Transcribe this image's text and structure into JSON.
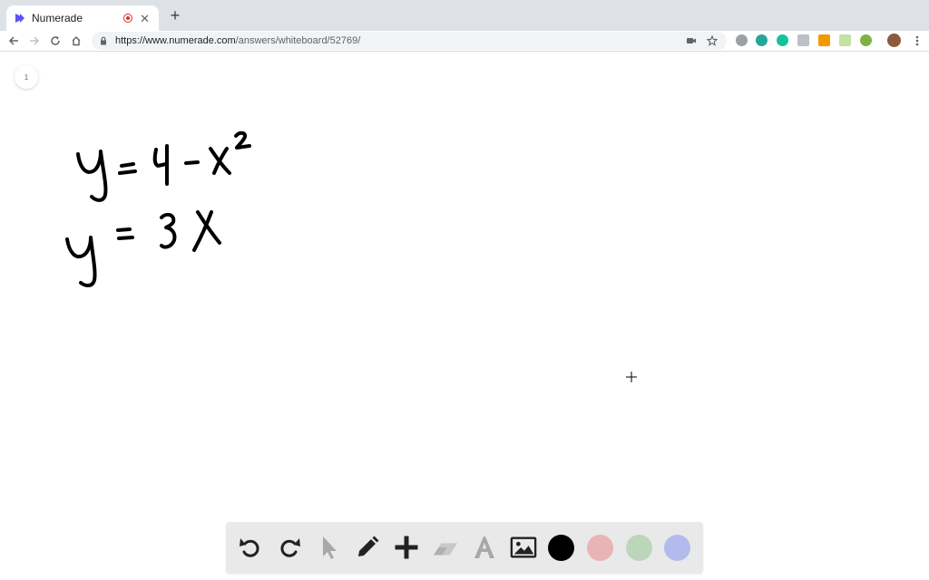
{
  "browser": {
    "tab": {
      "title": "Numerade"
    },
    "new_tab_label": "+",
    "address": {
      "url_host": "https://www.numerade.com",
      "url_path": "/answers/whiteboard/52769/"
    },
    "extensions": [
      {
        "name": "abp-icon",
        "color": "#9aa0a6"
      },
      {
        "name": "circle-teal-icon",
        "color": "#26a69a"
      },
      {
        "name": "grammarly-icon",
        "color": "#15c39a"
      },
      {
        "name": "notes-icon",
        "color": "#bdc1c6"
      },
      {
        "name": "key-icon",
        "color": "#f29900"
      },
      {
        "name": "screen-icon",
        "color": "#c5e1a5"
      },
      {
        "name": "chrome-ext-icon",
        "color": "#7cb342"
      },
      {
        "name": "profile-avatar",
        "color": "#8d5a3b"
      }
    ]
  },
  "whiteboard": {
    "page_number": "1",
    "colors": {
      "ink": "#000000",
      "black": "#000000",
      "pink": "#e8b4b4",
      "green": "#bcd6bc",
      "blue": "#b3bbec"
    }
  },
  "tools": [
    {
      "name": "undo-icon",
      "state": "enabled"
    },
    {
      "name": "redo-icon",
      "state": "enabled"
    },
    {
      "name": "pointer-icon",
      "state": "disabled"
    },
    {
      "name": "pencil-icon",
      "state": "enabled"
    },
    {
      "name": "plus-icon",
      "state": "enabled"
    },
    {
      "name": "eraser-icon",
      "state": "disabled"
    },
    {
      "name": "text-icon",
      "state": "disabled"
    },
    {
      "name": "image-icon",
      "state": "enabled"
    }
  ]
}
